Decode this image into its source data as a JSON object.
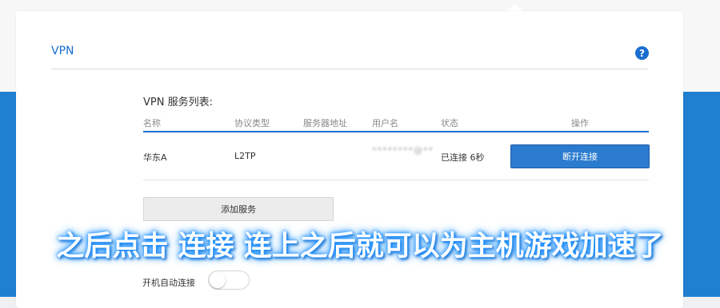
{
  "card": {
    "title": "VPN",
    "help_icon": "?"
  },
  "vpn_list": {
    "title": "VPN 服务列表:",
    "columns": [
      "名称",
      "协议类型",
      "服务器地址",
      "用户名",
      "状态",
      "操作"
    ],
    "rows": [
      {
        "name": "华东A",
        "protocol": "L2TP",
        "server": "",
        "username": "********@**",
        "status": "已连接 6秒",
        "action": "断开连接"
      }
    ]
  },
  "add_service_label": "添加服务",
  "autostart": {
    "label": "开机自动连接",
    "enabled": false
  },
  "caption": "之后点击 连接 连上之后就可以为主机游戏加速了",
  "colors": {
    "accent": "#1a6fd0",
    "button": "#2b7bcf",
    "background_band": "#1f7fd0"
  }
}
